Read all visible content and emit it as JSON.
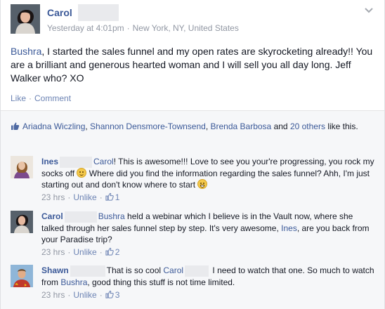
{
  "post": {
    "author": "Carol",
    "timestamp": "Yesterday at 4:01pm",
    "location": "New York, NY, United States",
    "text_mention": "Bushra",
    "text_body": ", I started the sales funnel and my open rates are skyrocketing already!! You are a brilliant and generous hearted woman and I will sell you all day long. Jeff Walker who? XO",
    "actions": {
      "like": "Like",
      "comment": "Comment"
    },
    "likes": {
      "names": [
        "Ariadna Wiczling",
        "Shannon Densmore-Townsend",
        "Brenda Barbosa"
      ],
      "and": "and",
      "others": "20 others",
      "suffix": "like this."
    }
  },
  "comments": [
    {
      "author": "Ines",
      "mention": "Carol",
      "text1": "! This is awesome!!! Love to see you your're progressing, you rock my socks off ",
      "text2": " Where did you find the information regarding the sales funnel? Ahh, I'm just starting out and don't know where to start ",
      "time": "23 hrs",
      "unlike": "Unlike",
      "likes": "1"
    },
    {
      "author": "Carol",
      "mention": "Bushra",
      "text1": " held a webinar which I believe is in the Vault now, where she talked through her sales funnel step by step. It's very awesome, ",
      "mention2": "Ines",
      "text2": ", are you back from your Paradise trip?",
      "time": "23 hrs",
      "unlike": "Unlike",
      "likes": "2"
    },
    {
      "author": "Shawn",
      "text1": "That is so cool ",
      "mention": "Carol",
      "text2": " I need to watch that one. So much to watch from ",
      "mention2": "Bushra",
      "text3": ", good thing this stuff is not time limited.",
      "time": "23 hrs",
      "unlike": "Unlike",
      "likes": "3"
    }
  ],
  "colors": {
    "link": "#3b5998",
    "meta": "#9197a3",
    "panel": "#f6f7f9"
  }
}
